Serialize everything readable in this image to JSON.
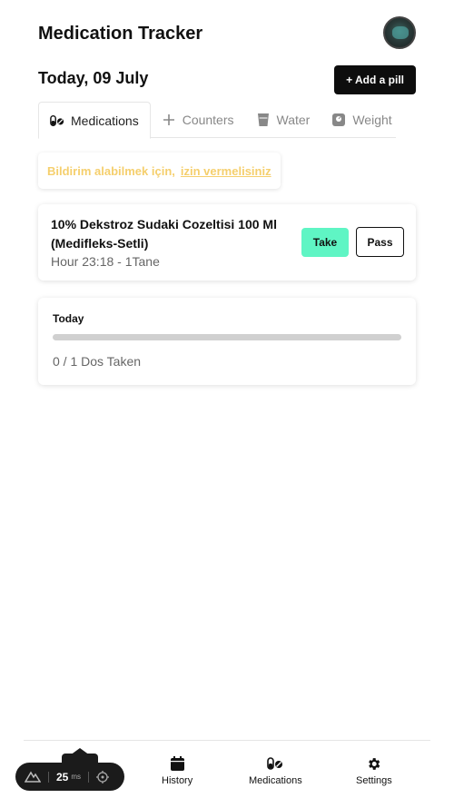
{
  "header": {
    "title": "Medication Tracker"
  },
  "date_row": {
    "date": "Today, 09 July",
    "add_button": "+ Add a pill"
  },
  "tabs": [
    {
      "label": "Medications",
      "icon": "pills-icon",
      "active": true
    },
    {
      "label": "Counters",
      "icon": "plus-icon",
      "active": false
    },
    {
      "label": "Water",
      "icon": "glass-icon",
      "active": false
    },
    {
      "label": "Weight",
      "icon": "scale-icon",
      "active": false
    }
  ],
  "notice": {
    "text": "Bildirim alabilmek için,",
    "link": "izin vermelisiniz"
  },
  "medication": {
    "name": "10% Dekstroz Sudaki Cozeltisi 100 Ml (Medifleks-Setli)",
    "info": "Hour 23:18 - 1Tane",
    "take_label": "Take",
    "pass_label": "Pass"
  },
  "progress": {
    "label": "Today",
    "text": "0 / 1 Dos Taken",
    "taken": 0,
    "total": 1
  },
  "bottom_nav": [
    {
      "label": "History",
      "icon": "calendar-icon"
    },
    {
      "label": "Medications",
      "icon": "pills-icon"
    },
    {
      "label": "Settings",
      "icon": "gear-icon"
    }
  ],
  "dev_toolbar": {
    "value": "25",
    "unit": "ms"
  },
  "colors": {
    "accent": "#5ff5c4",
    "notice": "#f5cf6d",
    "primary": "#0d0d0d"
  }
}
